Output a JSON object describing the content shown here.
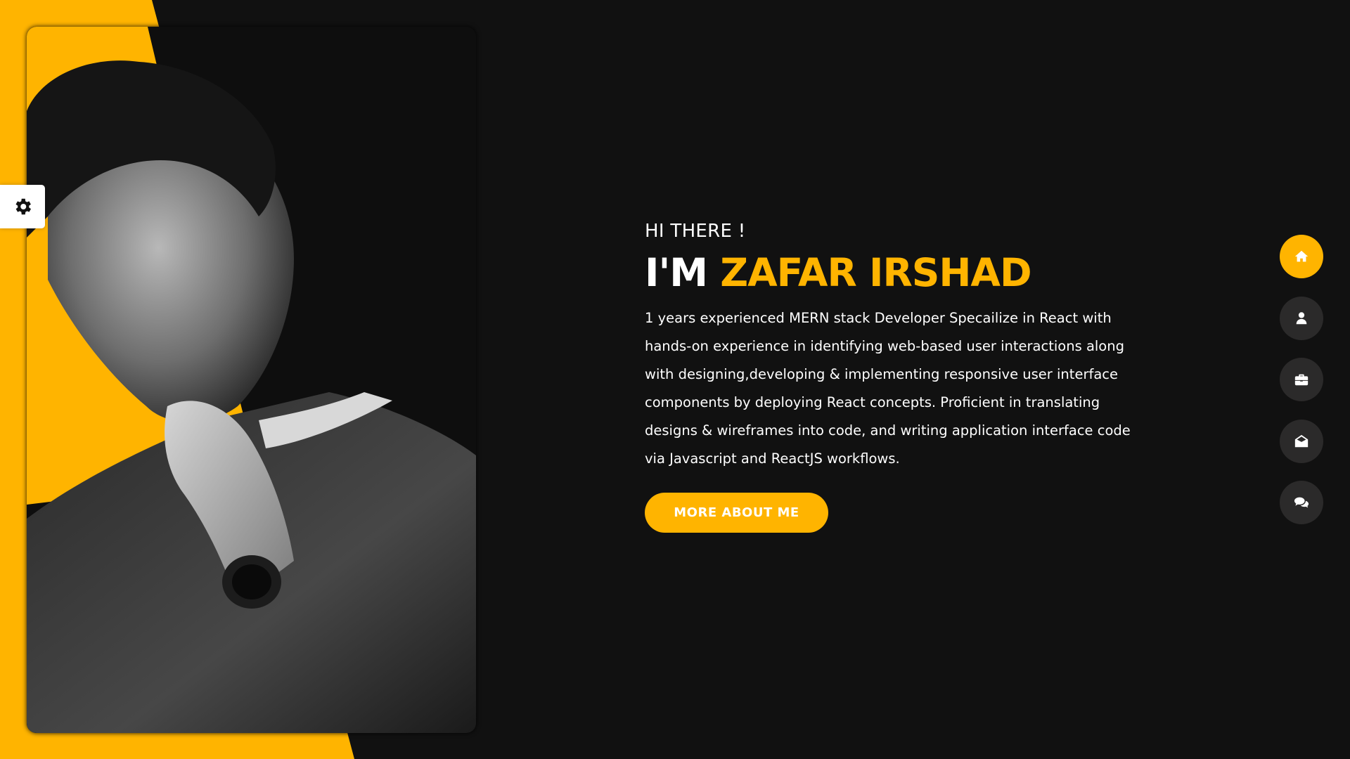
{
  "theme": {
    "accent": "#ffb400",
    "background": "#111111",
    "nav_bg": "#2b2a2a",
    "text": "#ffffff"
  },
  "settings": {
    "icon": "gear-icon"
  },
  "hero": {
    "greeting": "HI THERE !",
    "prefix": "I'M",
    "name": "ZAFAR IRSHAD",
    "bio": "1 years experienced MERN stack Developer Specailize in React with hands-on experience in identifying web-based user interactions along with designing,developing & implementing responsive user interface components by deploying React concepts. Proficient in translating designs & wireframes into code, and writing application interface code via Javascript and ReactJS workflows.",
    "cta_label": "MORE ABOUT ME"
  },
  "nav": {
    "items": [
      {
        "icon": "home-icon",
        "active": true
      },
      {
        "icon": "user-icon",
        "active": false
      },
      {
        "icon": "briefcase-icon",
        "active": false
      },
      {
        "icon": "envelope-open-icon",
        "active": false
      },
      {
        "icon": "comments-icon",
        "active": false
      }
    ]
  }
}
